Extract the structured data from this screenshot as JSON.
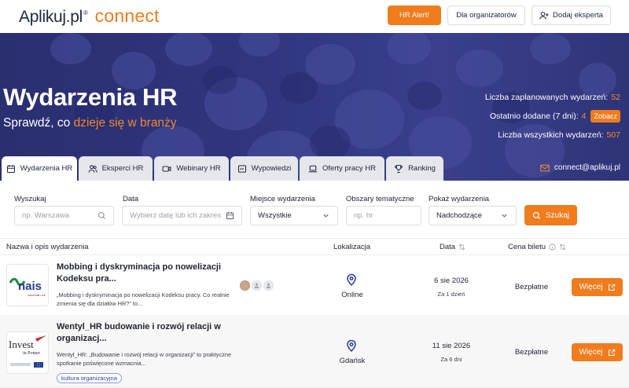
{
  "header": {
    "logo_brand": "Aplikuj.pl",
    "logo_reg": "®",
    "logo_product": "connect",
    "hr_alert_label": "HR Alert!",
    "organizers_label": "Dla organizatorów",
    "add_expert_label": "Dodaj eksperta"
  },
  "hero": {
    "title": "Wydarzenia HR",
    "subtitle_pre": "Sprawdź, co ",
    "subtitle_highlight": "dzieje się w branży",
    "stats": {
      "planned_label": "Liczba zaplanowanych wydarzeń:",
      "planned_value": "52",
      "recent_label": "Ostatnio dodane (7 dni):",
      "recent_value": "4",
      "recent_button": "Zobacz",
      "total_label": "Liczba wszystkich wydarzeń:",
      "total_value": "507"
    },
    "email": "connect@aplikuj.pl"
  },
  "tabs": [
    {
      "label": "Wydarzenia HR",
      "icon": "calendar-icon",
      "active": true
    },
    {
      "label": "Eksperci HR",
      "icon": "users-icon",
      "active": false
    },
    {
      "label": "Webinary HR",
      "icon": "video-icon",
      "active": false
    },
    {
      "label": "Wypowiedzi",
      "icon": "quote-icon",
      "active": false
    },
    {
      "label": "Oferty pracy HR",
      "icon": "laptop-icon",
      "active": false
    },
    {
      "label": "Ranking",
      "icon": "trophy-icon",
      "active": false
    }
  ],
  "filters": {
    "search_label": "Wyszukaj",
    "search_placeholder": "np. Warszawa",
    "date_label": "Data",
    "date_placeholder": "Wybierz datę lub ich zakres",
    "place_label": "Miejsce wydarzenia",
    "place_value": "Wszystkie",
    "topics_label": "Obszary tematyczne",
    "topics_placeholder": "np. hr",
    "show_label": "Pokaż wydarzenia",
    "show_value": "Nadchodzące",
    "search_button": "Szukaj"
  },
  "table": {
    "headers": {
      "name": "Nazwa i opis wydarzenia",
      "location": "Lokalizacja",
      "date": "Data",
      "price": "Cena biletu"
    },
    "rows": [
      {
        "logo": "nais",
        "logo_sub": "szkolenia",
        "title": "Mobbing i dyskryminacja po nowelizacji Kodeksu pra...",
        "description": "„Mobbing i dyskryminacja po nowelizacji Kodeksu pracy. Co realnie zmienia się dla działów HR?” to...",
        "location": "Online",
        "date": "6 sie 2026",
        "date_relative": "Za 1 dzień",
        "price": "Bezpłatne",
        "more_label": "Więcej"
      },
      {
        "logo": "Invest",
        "logo_sub": "in Pomer",
        "title": "Wentyl_HR budowanie i rozwój relacji w organizacj...",
        "description": "Wentyl_HR: „Budowanie i rozwój relacji w organizacji” to praktyczne spotkanie poświęcone wzmacnia...",
        "tag": "kultura organizacyjna",
        "location": "Gdańsk",
        "date": "11 sie 2026",
        "date_relative": "Za 6 dni",
        "price": "Bezpłatne",
        "more_label": "Więcej"
      }
    ]
  },
  "colors": {
    "accent": "#f07c1e",
    "hero_bg": "#30357e",
    "text": "#1f2330"
  }
}
